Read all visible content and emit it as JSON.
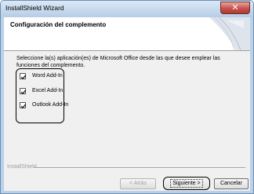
{
  "window": {
    "title": "InstallShield Wizard",
    "close_glyph": "✕"
  },
  "header": {
    "title": "Configuración del complemento"
  },
  "description": "Seleccione la(s) aplicación(es) de Microsoft Office desde las que desee emplear las funciones del complemento.",
  "addins": [
    {
      "label": "Word Add-In",
      "checked": true
    },
    {
      "label": "Excel Add-In",
      "checked": true
    },
    {
      "label": "Outlook Add-In",
      "checked": true
    }
  ],
  "footer": {
    "brand": "InstallShield"
  },
  "buttons": {
    "back": "< Atrás",
    "next": "Siguiente >",
    "cancel": "Cancelar"
  },
  "colors": {
    "title_gradient_top": "#dbe8f6",
    "close_red": "#c75050",
    "client_bg": "#f0f0f0"
  },
  "icons": [
    "close-icon",
    "checkmark-icon",
    "wizard-header-graphic"
  ]
}
